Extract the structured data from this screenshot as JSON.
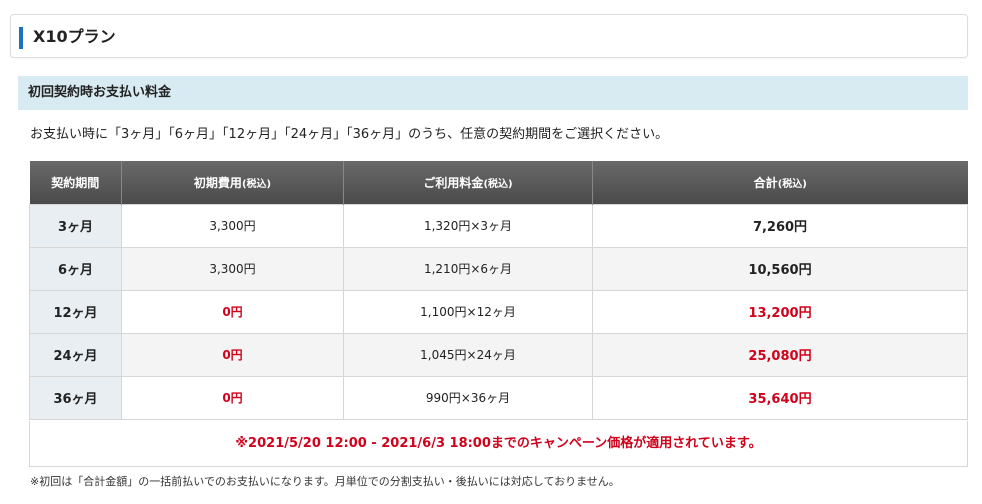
{
  "plan": {
    "title": "X10プラン"
  },
  "section": {
    "heading": "初回契約時お支払い料金"
  },
  "description": "お支払い時に「3ヶ月」「6ヶ月」「12ヶ月」「24ヶ月」「36ヶ月」のうち、任意の契約期間をご選択ください。",
  "table": {
    "headers": {
      "period": "契約期間",
      "initial": "初期費用",
      "initial_tax": "(税込)",
      "fee": "ご利用料金",
      "fee_tax": "(税込)",
      "total": "合計",
      "total_tax": "(税込)"
    },
    "rows": [
      {
        "period": "3ヶ月",
        "initial": "3,300円",
        "fee": "1,320円×3ヶ月",
        "total": "7,260円"
      },
      {
        "period": "6ヶ月",
        "initial": "3,300円",
        "fee": "1,210円×6ヶ月",
        "total": "10,560円"
      },
      {
        "period": "12ヶ月",
        "initial": "0円",
        "fee": "1,100円×12ヶ月",
        "total": "13,200円"
      },
      {
        "period": "24ヶ月",
        "initial": "0円",
        "fee": "1,045円×24ヶ月",
        "total": "25,080円"
      },
      {
        "period": "36ヶ月",
        "initial": "0円",
        "fee": "990円×36ヶ月",
        "total": "35,640円"
      }
    ]
  },
  "campaign": "※2021/5/20 12:00 - 2021/6/3 18:00までのキャンペーン価格が適用されています。",
  "footnote": "※初回は「合計金額」の一括前払いでのお支払いになります。月単位での分割支払い・後払いには対応しておりません。",
  "colors": {
    "accent": "#1e73be",
    "highlight": "#d0021b",
    "section_bg": "#d9ebf2"
  }
}
